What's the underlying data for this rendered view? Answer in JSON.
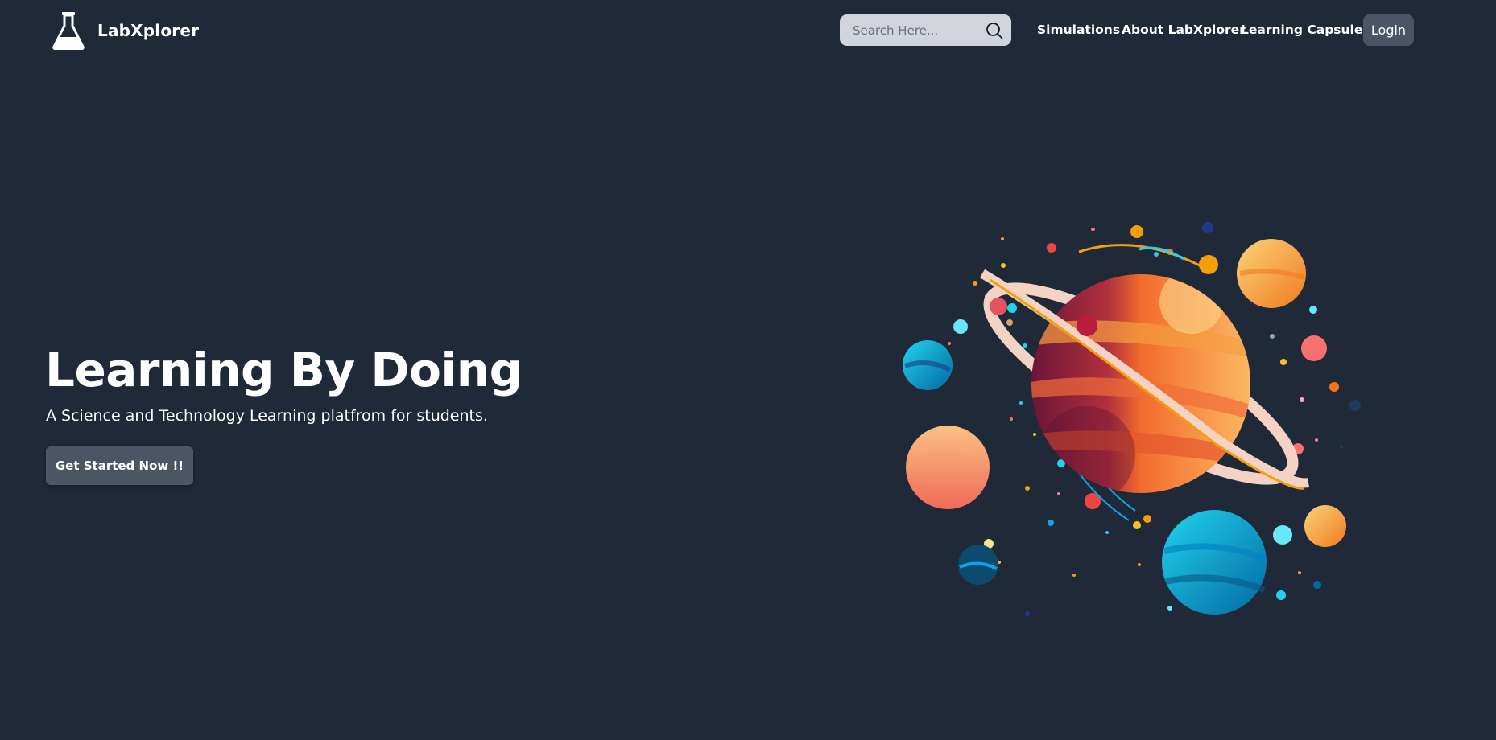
{
  "header": {
    "brand_name": "LabXplorer",
    "brand_logo_icon": "flask-icon",
    "search": {
      "placeholder": "Search Here...",
      "value": "",
      "icon": "search-icon"
    },
    "nav": [
      {
        "label": "Simulations"
      },
      {
        "label": "About LabXplorer"
      },
      {
        "label": "Learning Capsules"
      }
    ],
    "login_label": "Login"
  },
  "hero": {
    "title": "Learning By Doing",
    "subtitle": "A Science and Technology Learning platfrom for students.",
    "cta_label": "Get Started Now !!",
    "illustration": "planets-space-illustration"
  },
  "colors": {
    "background": "#1f2937",
    "search_bg": "#d1d5db",
    "button_bg": "#4b5563",
    "text": "#ffffff",
    "planet_orange": "#f59e42",
    "planet_blue": "#0ea5e9",
    "planet_maroon": "#7f1d3d"
  }
}
